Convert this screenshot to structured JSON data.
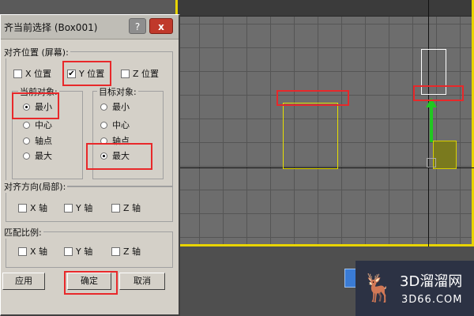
{
  "dialog": {
    "title": "齐当前选择 (Box001)",
    "help_label": "?",
    "close_label": "x",
    "align_position": {
      "label": "对齐位置 (屏幕):",
      "checks": [
        {
          "label": "X 位置",
          "checked": false,
          "check_mark": ""
        },
        {
          "label": "Y 位置",
          "checked": true,
          "check_mark": "✔"
        },
        {
          "label": "Z 位置",
          "checked": false,
          "check_mark": ""
        }
      ],
      "current_object": {
        "label": "当前对象:",
        "options": [
          {
            "label": "最小",
            "selected": true
          },
          {
            "label": "中心",
            "selected": false
          },
          {
            "label": "轴点",
            "selected": false
          },
          {
            "label": "最大",
            "selected": false
          }
        ]
      },
      "target_object": {
        "label": "目标对象:",
        "options": [
          {
            "label": "最小",
            "selected": false
          },
          {
            "label": "中心",
            "selected": false
          },
          {
            "label": "轴点",
            "selected": false
          },
          {
            "label": "最大",
            "selected": true
          }
        ]
      }
    },
    "align_orientation": {
      "label": "对齐方向(局部):",
      "checks": [
        {
          "label": "X 轴",
          "checked": false
        },
        {
          "label": "Y 轴",
          "checked": false
        },
        {
          "label": "Z 轴",
          "checked": false
        }
      ]
    },
    "match_scale": {
      "label": "匹配比例:",
      "checks": [
        {
          "label": "X 轴",
          "checked": false
        },
        {
          "label": "Y 轴",
          "checked": false
        },
        {
          "label": "Z 轴",
          "checked": false
        }
      ]
    },
    "buttons": {
      "apply": "应用",
      "ok": "确定",
      "cancel": "取消"
    }
  },
  "watermark": {
    "brand": "3D溜溜网",
    "url": "3D66.COM",
    "deer_glyph": "🦌"
  },
  "colors": {
    "highlight": "#e8282a",
    "viewport_border": "#e8d400",
    "gizmo_y": "#21c821"
  }
}
